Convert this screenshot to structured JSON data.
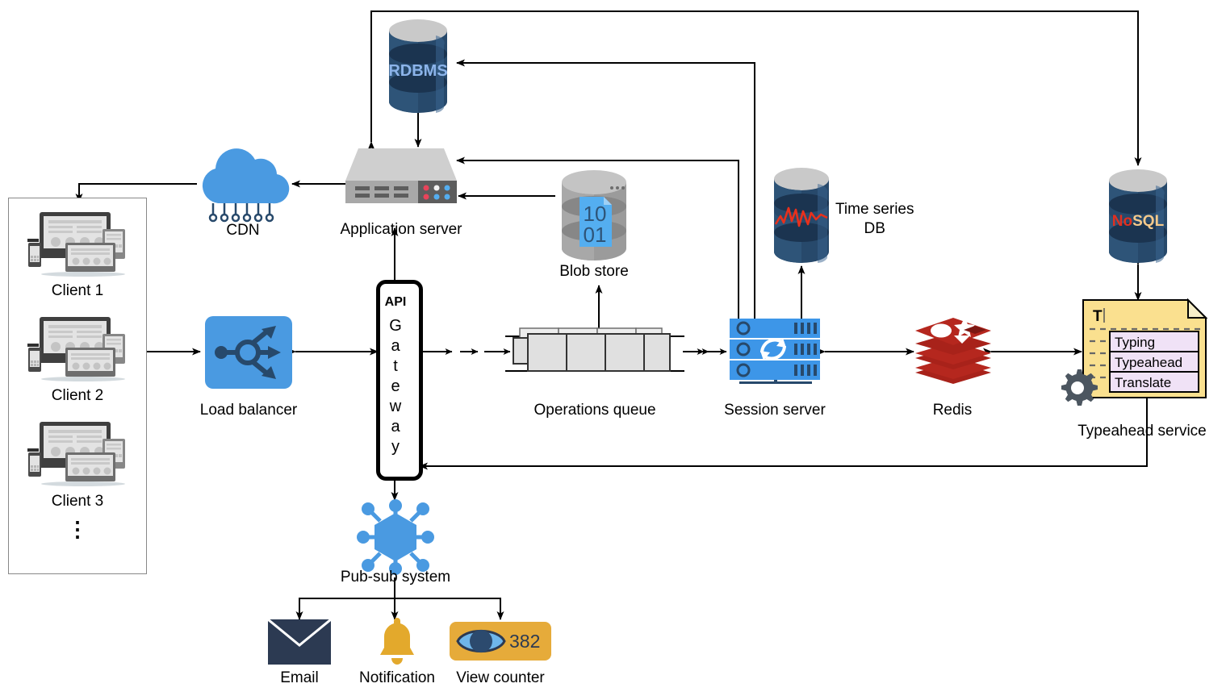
{
  "diagram": {
    "title": "System architecture diagram",
    "type": "system-architecture"
  },
  "clients": {
    "items": [
      {
        "label": "Client 1"
      },
      {
        "label": "Client 2"
      },
      {
        "label": "Client 3"
      }
    ],
    "ellipsis": "⋮"
  },
  "nodes": {
    "cdn": {
      "label": "CDN",
      "icon": "cloud-icon",
      "color": "#4a9ae1"
    },
    "app_server": {
      "label": "Application server",
      "icon": "server-icon",
      "color": "#c9c9c9"
    },
    "rdbms": {
      "label": "RDBMS",
      "icon": "database-icon",
      "color": "#27496b",
      "text_color": "#8cb4ea"
    },
    "blob_store": {
      "label": "Blob store",
      "icon": "blob-database-icon",
      "color": "#9b9b9b",
      "file_text_top": "10",
      "file_text_bottom": "01",
      "file_color": "#54aef0"
    },
    "load_balancer": {
      "label": "Load balancer",
      "icon": "load-balancer-icon",
      "color": "#4a9ae1"
    },
    "api_gateway": {
      "label_top": "API",
      "label_vertical": "Gateway",
      "icon": "api-gateway-icon"
    },
    "operations_queue": {
      "label": "Operations queue",
      "icon": "queue-icon"
    },
    "session_server": {
      "label": "Session server",
      "icon": "session-server-icon",
      "color": "#3d96e8"
    },
    "time_series_db": {
      "label_line1": "Time series",
      "label_line2": "DB",
      "icon": "timeseries-database-icon",
      "color": "#27496b",
      "wave_color": "#e8301c"
    },
    "redis": {
      "label": "Redis",
      "icon": "redis-icon",
      "color": "#b5271e"
    },
    "nosql": {
      "label": "NoSQL",
      "label_part1": "No",
      "label_part2": "SQL",
      "icon": "database-icon",
      "color": "#27496b",
      "text_color_1": "#e03020",
      "text_color_2": "#f5c98a"
    },
    "typeahead": {
      "label": "Typeahead service",
      "icon": "typeahead-document-icon",
      "cursor_text": "T",
      "suggestions": [
        "Typing",
        "Typeahead",
        "Translate"
      ],
      "doc_color": "#fae08f",
      "suggestion_color": "#f0e2f6",
      "gear_icon": "gear-icon"
    },
    "pubsub": {
      "label": "Pub-sub system",
      "icon": "pubsub-hexagon-icon",
      "color": "#4a9ae1"
    },
    "email": {
      "label": "Email",
      "icon": "envelope-icon",
      "color": "#2c3a52"
    },
    "notification": {
      "label": "Notification",
      "icon": "bell-icon",
      "color": "#e3a92c"
    },
    "view_counter": {
      "label": "View counter",
      "icon": "eye-icon",
      "count": "382",
      "color": "#e6ab3a"
    }
  }
}
